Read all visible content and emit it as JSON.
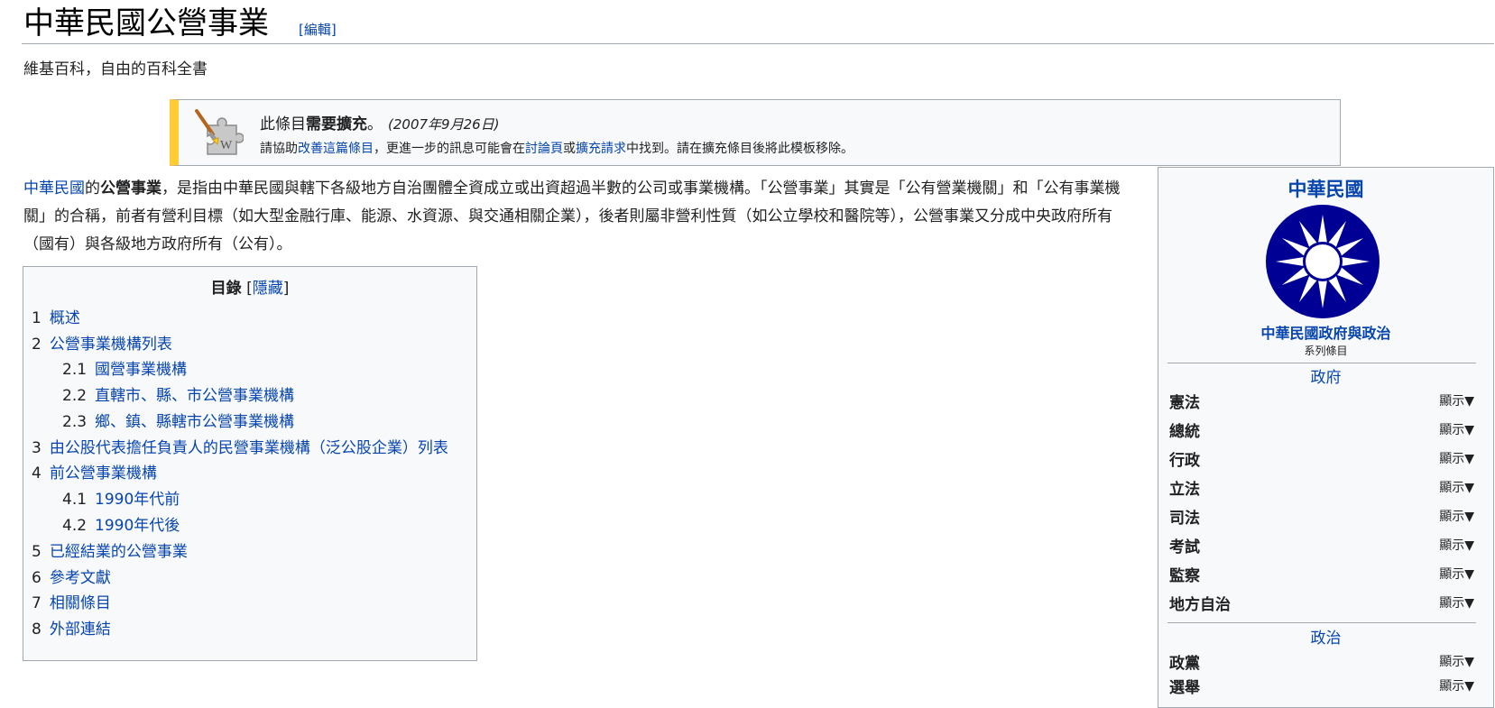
{
  "header": {
    "title": "中華民國公營事業",
    "edit_label": "[編輯]",
    "tagline": "維基百科，自由的百科全書"
  },
  "ambox": {
    "line1_prefix": "此條目",
    "line1_bold": "需要擴充",
    "line1_suffix": "。",
    "date": "(2007年9月26日)",
    "line2_a": "請協助",
    "link_improve": "改善這篇條目",
    "line2_b": "，更進一步的訊息可能會在",
    "link_talk": "討論頁",
    "line2_c": "或",
    "link_request": "擴充請求",
    "line2_d": "中找到。請在擴充條目後將此模板移除。"
  },
  "lead": {
    "link_roc": "中華民國",
    "t1": "的",
    "bold": "公營事業",
    "t2": "，是指由中華民國與轄下各級地方自治團體全資成立或出資超過半數的公司或事業機構。「公營事業」其實是「公有營業機關」和「公有事業機關」的合稱，前者有營利目標（如大型金融行庫、能源、水資源、與交通相關企業），後者則屬非營利性質（如公立學校和醫院等），公營事業又分成中央政府所有（國有）與各級地方政府所有（公有）。"
  },
  "toc": {
    "title": "目錄",
    "hide_label": "隱藏",
    "items": [
      {
        "num": "1",
        "label": "概述"
      },
      {
        "num": "2",
        "label": "公營事業機構列表"
      },
      {
        "num": "2.1",
        "label": "國營事業機構"
      },
      {
        "num": "2.2",
        "label": "直轄市、縣、市公營事業機構"
      },
      {
        "num": "2.3",
        "label": "鄉、鎮、縣轄市公營事業機構"
      },
      {
        "num": "3",
        "label": "由公股代表擔任負責人的民營事業機構（泛公股企業）列表"
      },
      {
        "num": "4",
        "label": "前公營事業機構"
      },
      {
        "num": "4.1",
        "label": "1990年代前"
      },
      {
        "num": "4.2",
        "label": "1990年代後"
      },
      {
        "num": "5",
        "label": "已經結業的公營事業"
      },
      {
        "num": "6",
        "label": "參考文獻"
      },
      {
        "num": "7",
        "label": "相關條目"
      },
      {
        "num": "8",
        "label": "外部連結"
      }
    ]
  },
  "infobox": {
    "title": "中華民國",
    "series_title": "中華民國政府與政治",
    "series_sub": "系列條目",
    "section_gov": "政府",
    "rows_gov": [
      {
        "label": "憲法",
        "toggle": "顯示▼"
      },
      {
        "label": "總統",
        "toggle": "顯示▼"
      },
      {
        "label": "行政",
        "toggle": "顯示▼"
      },
      {
        "label": "立法",
        "toggle": "顯示▼"
      },
      {
        "label": "司法",
        "toggle": "顯示▼"
      },
      {
        "label": "考試",
        "toggle": "顯示▼"
      },
      {
        "label": "監察",
        "toggle": "顯示▼"
      },
      {
        "label": "地方自治",
        "toggle": "顯示▼"
      }
    ],
    "section_politics": "政治",
    "rows_politics": [
      {
        "label": "政黨",
        "toggle": "顯示▼"
      },
      {
        "label": "選舉",
        "toggle": "顯示▼"
      }
    ]
  },
  "colors": {
    "link": "#0645ad",
    "ambox_stripe": "#ffcc33",
    "emblem_blue": "#000095",
    "box_bg": "#f8f9fa",
    "border": "#a2a9b1"
  }
}
